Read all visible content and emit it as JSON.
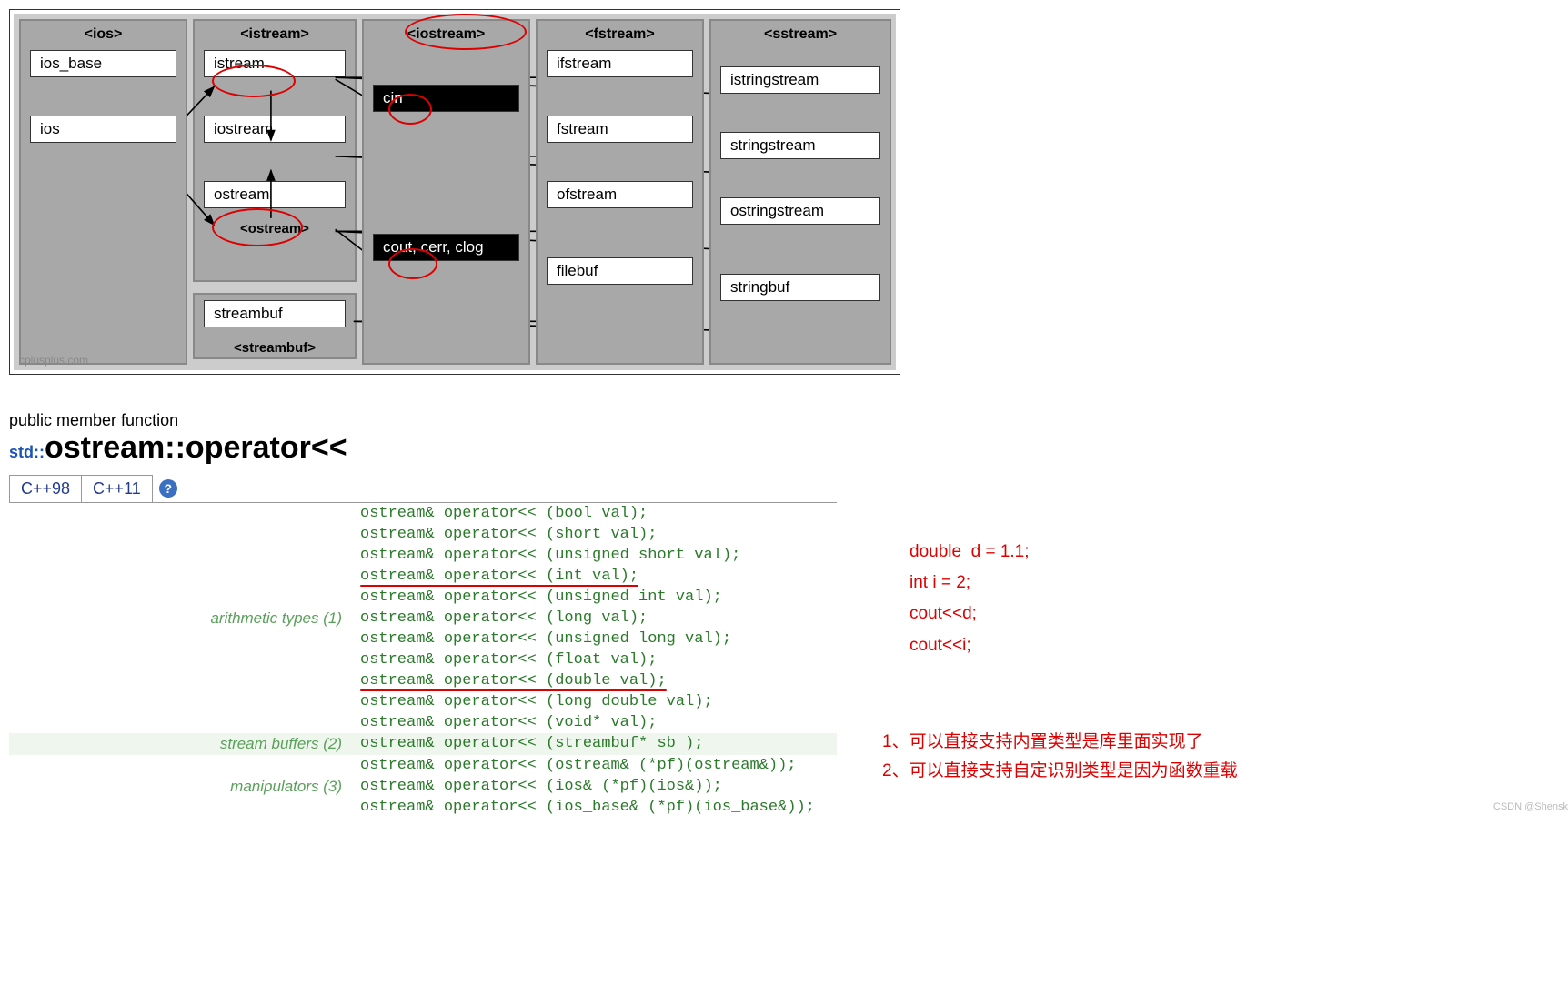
{
  "diagram": {
    "columns": {
      "ios": {
        "label": "<ios>",
        "nodes": [
          "ios_base",
          "ios"
        ]
      },
      "istream": {
        "label": "<istream>",
        "nodes": [
          "istream",
          "iostream",
          "ostream"
        ],
        "ostream_label": "<ostream>",
        "streambuf": {
          "node": "streambuf",
          "label": "<streambuf>"
        }
      },
      "iostream": {
        "label": "<iostream>",
        "nodes": [
          "cin",
          "cout, cerr, clog"
        ]
      },
      "fstream": {
        "label": "<fstream>",
        "nodes": [
          "ifstream",
          "fstream",
          "ofstream",
          "filebuf"
        ]
      },
      "sstream": {
        "label": "<sstream>",
        "nodes": [
          "istringstream",
          "stringstream",
          "ostringstream",
          "stringbuf"
        ]
      }
    },
    "watermark": "cplusplus.com"
  },
  "ref": {
    "kind": "public member function",
    "ns": "std::",
    "cls": "ostream",
    "sep": "::operator<<",
    "tabs": [
      "C++98",
      "C++11"
    ],
    "groups": [
      {
        "label": "arithmetic types (1)",
        "lines": [
          "ostream& operator<< (bool val);",
          "ostream& operator<< (short val);",
          "ostream& operator<< (unsigned short val);",
          "ostream& operator<< (int val);",
          "ostream& operator<< (unsigned int val);",
          "ostream& operator<< (long val);",
          "ostream& operator<< (unsigned long val);",
          "ostream& operator<< (float val);",
          "ostream& operator<< (double val);",
          "ostream& operator<< (long double val);",
          "ostream& operator<< (void* val);"
        ]
      },
      {
        "label": "stream buffers (2)",
        "lines": [
          "ostream& operator<< (streambuf* sb );"
        ]
      },
      {
        "label": "manipulators (3)",
        "lines": [
          "ostream& operator<< (ostream& (*pf)(ostream&));",
          "ostream& operator<< (ios& (*pf)(ios&));",
          "ostream& operator<< (ios_base& (*pf)(ios_base&));"
        ]
      }
    ]
  },
  "annotations": {
    "code": "double  d = 1.1;\nint i = 2;\ncout<<d;\ncout<<i;",
    "note1": "1、可以直接支持内置类型是库里面实现了",
    "note2": "2、可以直接支持自定识别类型是因为函数重载"
  },
  "csdn": "CSDN @Shensk"
}
